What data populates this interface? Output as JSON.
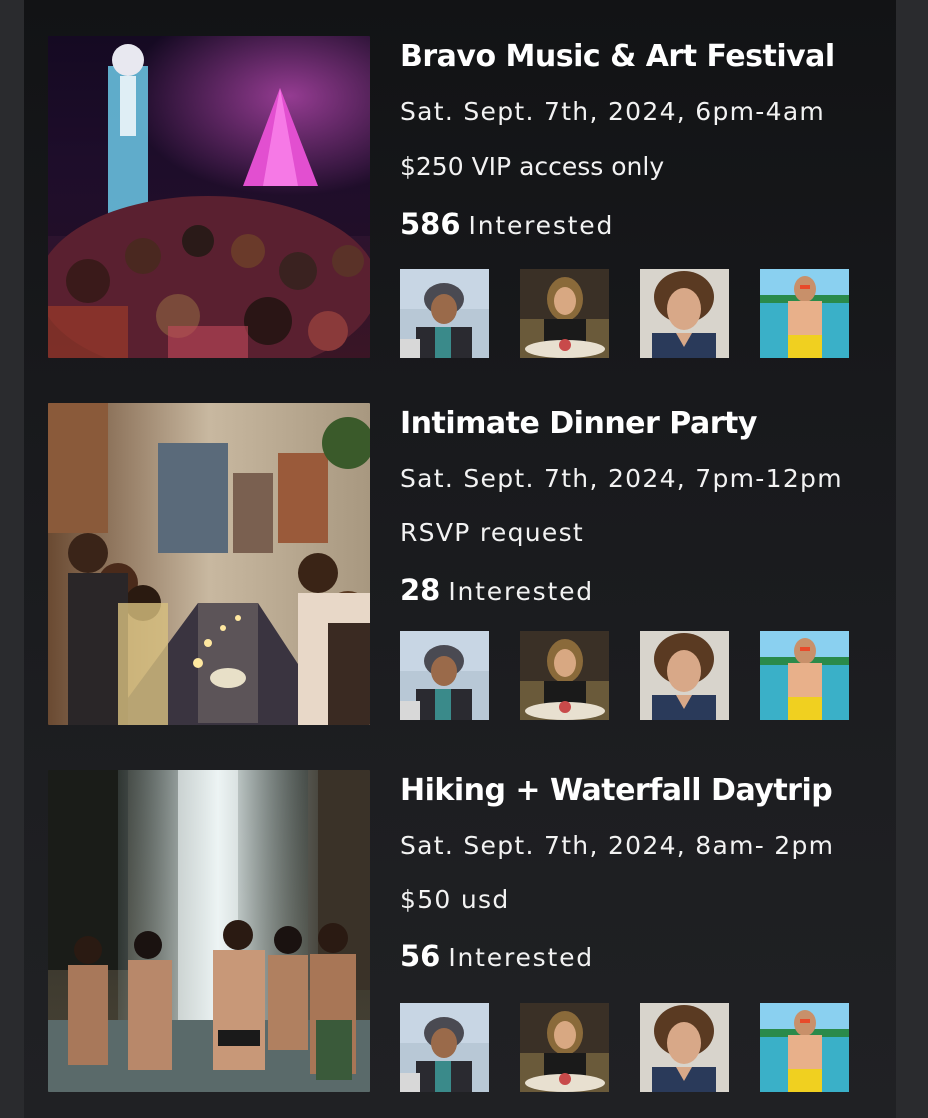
{
  "events": [
    {
      "title": "Bravo Music & Art Festival",
      "date": "Sat. Sept. 7th, 2024, 6pm-4am",
      "price": "$250 VIP access only",
      "interested_count": "586",
      "interested_label": "Interested",
      "image": "festival-crowd-photo"
    },
    {
      "title": "Intimate Dinner Party",
      "date": "Sat. Sept. 7th, 2024, 7pm-12pm",
      "price": "RSVP request",
      "interested_count": "28",
      "interested_label": "Interested",
      "image": "dinner-party-photo"
    },
    {
      "title": "Hiking + Waterfall Daytrip",
      "date": "Sat. Sept. 7th, 2024, 8am- 2pm",
      "price": "$50 usd",
      "interested_count": "56",
      "interested_label": "Interested",
      "image": "waterfall-photo"
    }
  ],
  "attendee_avatars": [
    "woman-with-hat-avatar",
    "woman-at-dinner-avatar",
    "curly-hair-man-avatar",
    "man-at-beach-avatar"
  ],
  "colors": {
    "background": "#2a2b2e",
    "panel": "#18191c",
    "text": "#ffffff"
  }
}
